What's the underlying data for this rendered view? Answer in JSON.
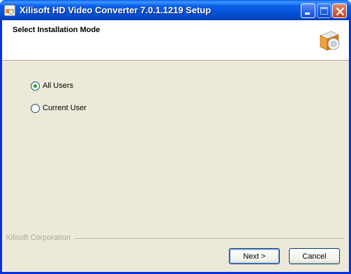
{
  "window": {
    "title": "Xilisoft HD Video Converter 7.0.1.1219 Setup",
    "app_icon": "xilisoft-app-icon",
    "buttons": [
      "minimize-icon",
      "maximize-icon",
      "close-icon"
    ]
  },
  "header": {
    "title": "Select Installation Mode",
    "icon": "installer-box-icon"
  },
  "options": [
    {
      "label": "All Users",
      "checked": true
    },
    {
      "label": "Current User",
      "checked": false
    }
  ],
  "footer": {
    "company": "Xilisoft Corporation",
    "next_label": "Next >",
    "cancel_label": "Cancel"
  },
  "colors": {
    "titlebar": "#0a5fe8",
    "dialog_bg": "#ece9d8",
    "radio_dot": "#21a121"
  }
}
